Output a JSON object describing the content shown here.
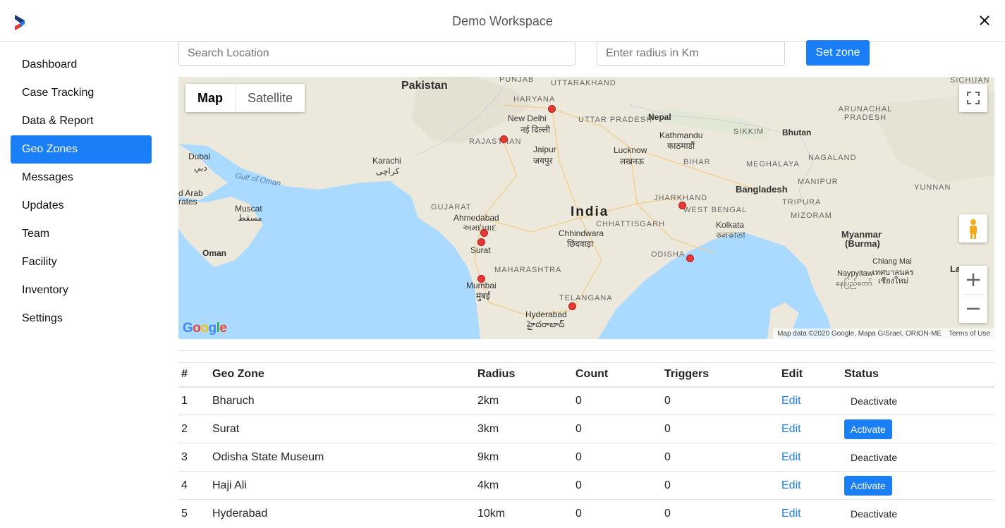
{
  "header": {
    "title": "Demo Workspace"
  },
  "sidebar": {
    "items": [
      {
        "label": "Dashboard"
      },
      {
        "label": "Case Tracking"
      },
      {
        "label": "Data & Report"
      },
      {
        "label": "Geo Zones"
      },
      {
        "label": "Messages"
      },
      {
        "label": "Updates"
      },
      {
        "label": "Team"
      },
      {
        "label": "Facility"
      },
      {
        "label": "Inventory"
      },
      {
        "label": "Settings"
      }
    ],
    "active": "Geo Zones"
  },
  "search": {
    "placeholder": "Search Location",
    "value": ""
  },
  "radius": {
    "placeholder": "Enter radius in Km",
    "value": ""
  },
  "set_zone_label": "Set zone",
  "map": {
    "type_map": "Map",
    "type_satellite": "Satellite",
    "logo": "Google",
    "attribution": "Map data ©2020 Google, Mapa GISrael, ORION-ME",
    "terms": "Terms of Use",
    "labels": {
      "pakistan": "Pakistan",
      "punjab": "PUNJAB",
      "haryana": "HARYANA",
      "uttarakhand": "UTTARAKHAND",
      "new_delhi": "New Delhi",
      "new_delhi_hi": "नई दिल्ली",
      "uttar_pradesh": "UTTAR PRADESH",
      "nepal": "Nepal",
      "kathmandu": "Kathmandu",
      "kathmandu_ne": "काठमाडौं",
      "sikkim": "SIKKIM",
      "bhutan": "Bhutan",
      "arunachal": "ARUNACHAL PRADESH",
      "sichuan": "SICHUAN",
      "rajasthan": "RAJASTHAN",
      "jaipur": "Jaipur",
      "jaipur_hi": "जयपुर",
      "lucknow": "Lucknow",
      "lucknow_hi": "लखनऊ",
      "bihar": "BIHAR",
      "meghalaya": "MEGHALAYA",
      "nagaland": "NAGALAND",
      "dubai": "Dubai",
      "dubai_ar": "دبي",
      "karachi": "Karachi",
      "karachi_ur": "کراچی",
      "gulf_of_oman": "Gulf of Oman",
      "bangladesh": "Bangladesh",
      "manipur": "MANIPUR",
      "yunnan": "YUNNAN",
      "uae": "d Arab",
      "rates": "rates",
      "muscat": "Muscat",
      "muscat_ar": "مسقط",
      "gujarat": "GUJARAT",
      "ahmedabad": "Ahmedabad",
      "ahmedabad_gu": "અમદાવાદ",
      "india": "India",
      "jharkhand": "JHARKHAND",
      "west_bengal": "WEST BENGAL",
      "tripura": "TRIPURA",
      "mizoram": "MIZORAM",
      "kolkata": "Kolkata",
      "kolkata_bn": "কলকাতা",
      "chhattisgarh": "CHHATTISGARH",
      "chhindwara": "Chhindwara",
      "chhindwara_hi": "छिंदवाड़ा",
      "myanmar": "Myanmar",
      "burma": "(Burma)",
      "oman": "Oman",
      "surat": "Surat",
      "odisha": "ODISHA",
      "maharashtra": "MAHARASHTRA",
      "chiang_mai": "Chiang Mai",
      "chiang_mai_th": "เทศบาลนคร",
      "chiang_mai_th2": "เชียงใหม่",
      "lao": "La",
      "mumbai": "Mumbai",
      "mumbai_hi": "मुंबई",
      "naypyitaw": "Naypyitaw",
      "naypyitaw_my": "နေပြည်တော်",
      "telangana": "TELANGANA",
      "hyderabad": "Hyderabad",
      "hyderabad_te": "హైదరాబాద్"
    }
  },
  "table": {
    "headers": [
      "#",
      "Geo Zone",
      "Radius",
      "Count",
      "Triggers",
      "Edit",
      "Status"
    ],
    "rows": [
      {
        "num": "1",
        "zone": "Bharuch",
        "radius": "2km",
        "count": "0",
        "triggers": "0",
        "edit": "Edit",
        "status": "Deactivate",
        "status_active": false
      },
      {
        "num": "2",
        "zone": "Surat",
        "radius": "3km",
        "count": "0",
        "triggers": "0",
        "edit": "Edit",
        "status": "Activate",
        "status_active": true
      },
      {
        "num": "3",
        "zone": "Odisha State Museum",
        "radius": "9km",
        "count": "0",
        "triggers": "0",
        "edit": "Edit",
        "status": "Deactivate",
        "status_active": false
      },
      {
        "num": "4",
        "zone": "Haji Ali",
        "radius": "4km",
        "count": "0",
        "triggers": "0",
        "edit": "Edit",
        "status": "Activate",
        "status_active": true
      },
      {
        "num": "5",
        "zone": "Hyderabad",
        "radius": "10km",
        "count": "0",
        "triggers": "0",
        "edit": "Edit",
        "status": "Deactivate",
        "status_active": false
      }
    ]
  },
  "colors": {
    "accent": "#1a7ff7",
    "marker": "#e53935",
    "water": "#aadaff",
    "land": "#ece8dc"
  }
}
